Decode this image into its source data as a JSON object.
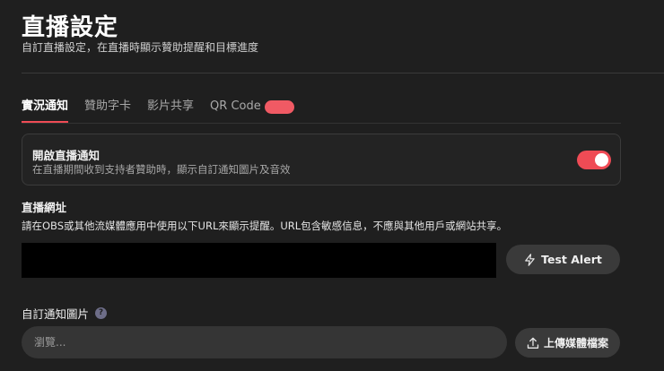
{
  "header": {
    "title": "直播設定",
    "subtitle": "自訂直播設定，在直播時顯示贊助提醒和目標進度"
  },
  "tabs": [
    {
      "label": "實況通知",
      "active": true
    },
    {
      "label": "贊助字卡",
      "active": false
    },
    {
      "label": "影片共享",
      "active": false
    },
    {
      "label": "QR Code",
      "active": false
    }
  ],
  "notification_card": {
    "title": "開啟直播通知",
    "description": "在直播期間收到支持者贊助時，顯示自訂通知圖片及音效",
    "enabled": true
  },
  "stream_url": {
    "label": "直播網址",
    "description": "請在OBS或其他流媒體應用中使用以下URL來顯示提醒。URL包含敏感信息，不應與其他用戶或網站共享。",
    "test_alert_label": "Test Alert"
  },
  "custom_image": {
    "label": "自訂通知圖片",
    "help_icon": "?",
    "browse_placeholder": "瀏覽...",
    "upload_label": "上傳媒體檔案"
  },
  "colors": {
    "accent": "#ef4b55",
    "background": "#1f1f1f",
    "button": "#3a3a3a"
  }
}
